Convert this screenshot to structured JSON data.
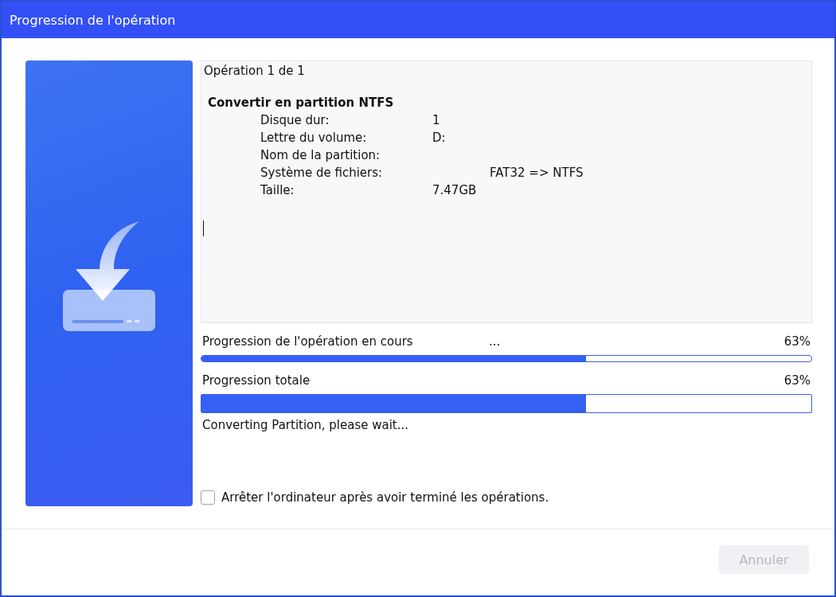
{
  "window": {
    "title": "Progression de l'opération"
  },
  "details": {
    "header": "Opération 1 de 1",
    "operation": "Convertir en partition NTFS",
    "rows": [
      {
        "label": "Disque dur:",
        "value": "1"
      },
      {
        "label": "Lettre du volume:",
        "value": "D:"
      },
      {
        "label": "Nom de la partition:"
      },
      {
        "label": "Système de fichiers:",
        "value_2": "FAT32 => NTFS"
      },
      {
        "label": "Taille:",
        "value": "7.47GB"
      }
    ]
  },
  "progress": [
    {
      "label": "Progression de l'opération en cours",
      "extra": "...",
      "reading": "63%",
      "level": 0.63,
      "kind": "thin"
    },
    {
      "label": "Progression totale",
      "reading": "63%",
      "level": 0.63,
      "kind": "thick"
    }
  ],
  "status": "Converting Partition, please wait...",
  "shutdown_option": {
    "label": "Arrêter l'ordinateur après avoir terminé les opérations.",
    "checked": false
  },
  "buttons": [
    {
      "label": "Annuler",
      "disabled": true
    }
  ]
}
